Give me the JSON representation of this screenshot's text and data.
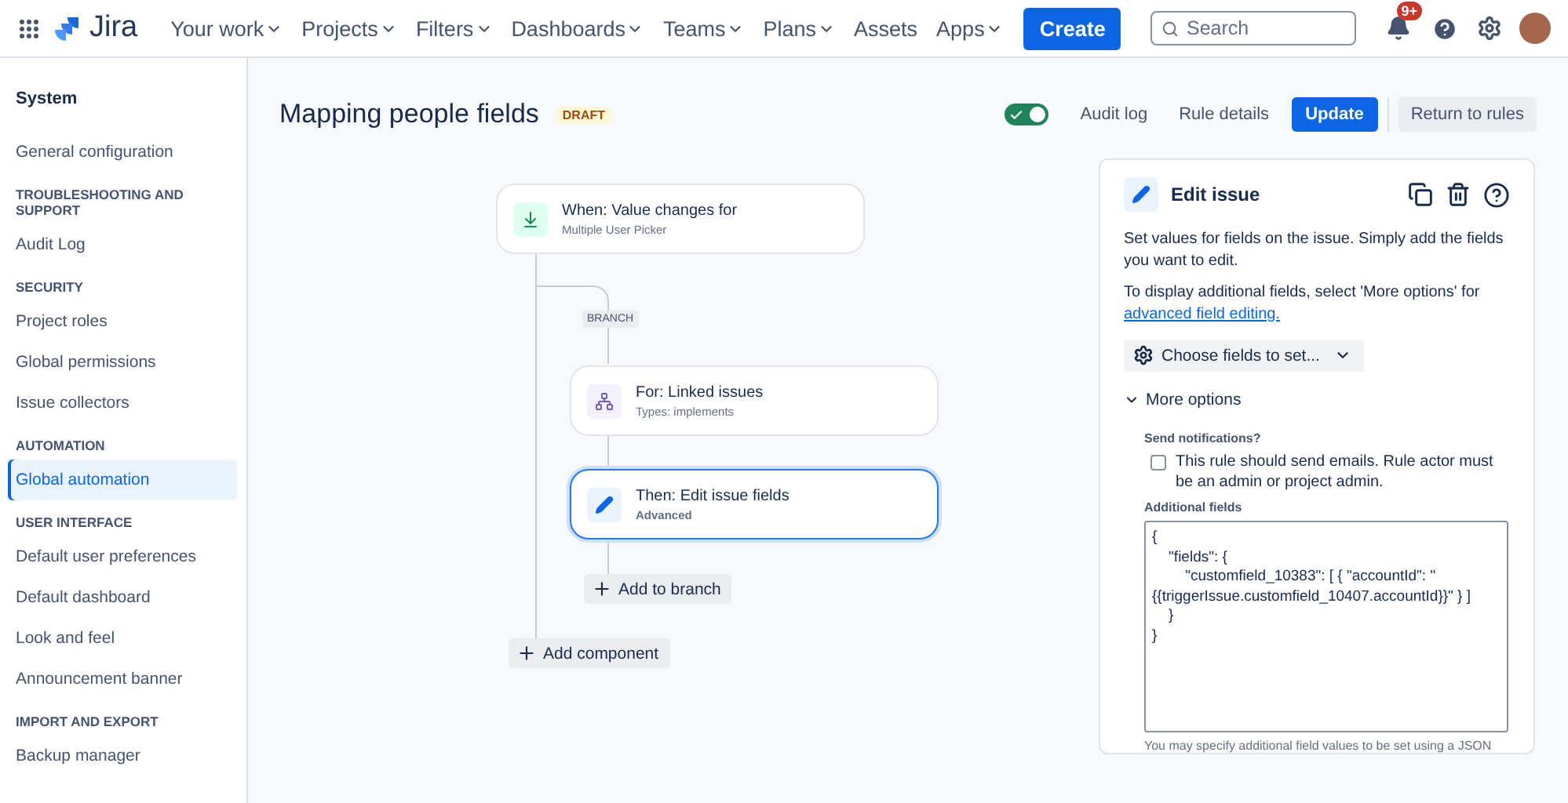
{
  "nav": {
    "product": "Jira",
    "items": [
      {
        "label": "Your work",
        "dropdown": true
      },
      {
        "label": "Projects",
        "dropdown": true
      },
      {
        "label": "Filters",
        "dropdown": true
      },
      {
        "label": "Dashboards",
        "dropdown": true
      },
      {
        "label": "Teams",
        "dropdown": true
      },
      {
        "label": "Plans",
        "dropdown": true
      },
      {
        "label": "Assets",
        "dropdown": false
      },
      {
        "label": "Apps",
        "dropdown": true
      }
    ],
    "create": "Create",
    "search": {
      "placeholder": "Search"
    },
    "notifications_badge": "9+"
  },
  "sidebar": {
    "title": "System",
    "sections": [
      {
        "items": [
          {
            "label": "General configuration",
            "selected": false
          }
        ]
      },
      {
        "heading": "TROUBLESHOOTING AND SUPPORT",
        "items": [
          {
            "label": "Audit Log",
            "selected": false
          }
        ]
      },
      {
        "heading": "SECURITY",
        "items": [
          {
            "label": "Project roles",
            "selected": false
          },
          {
            "label": "Global permissions",
            "selected": false
          },
          {
            "label": "Issue collectors",
            "selected": false
          }
        ]
      },
      {
        "heading": "AUTOMATION",
        "items": [
          {
            "label": "Global automation",
            "selected": true
          }
        ]
      },
      {
        "heading": "USER INTERFACE",
        "items": [
          {
            "label": "Default user preferences",
            "selected": false
          },
          {
            "label": "Default dashboard",
            "selected": false
          },
          {
            "label": "Look and feel",
            "selected": false
          },
          {
            "label": "Announcement banner",
            "selected": false
          }
        ]
      },
      {
        "heading": "IMPORT AND EXPORT",
        "items": [
          {
            "label": "Backup manager",
            "selected": false
          }
        ]
      }
    ]
  },
  "header": {
    "title": "Mapping people fields",
    "status": "DRAFT",
    "rule_enabled": true,
    "actions": [
      "Audit log",
      "Rule details"
    ],
    "update": "Update",
    "return": "Return to rules"
  },
  "flow": {
    "trigger": {
      "title": "When: Value changes for",
      "subtitle": "Multiple User Picker"
    },
    "branch_label": "BRANCH",
    "components": [
      {
        "kind": "branch",
        "title": "For: Linked issues",
        "subtitle": "Types: implements",
        "selected": false
      },
      {
        "kind": "action",
        "title": "Then: Edit issue fields",
        "subtitle": "Advanced",
        "selected": true
      }
    ],
    "add_to_branch": "Add to branch",
    "add_component": "Add component"
  },
  "panel": {
    "title": "Edit issue",
    "description": "Set values for fields on the issue. Simply add the fields you want to edit.",
    "hint": "To display additional fields, select 'More options' for",
    "hint_link": "advanced field editing.",
    "choose_fields": "Choose fields to set...",
    "more_options": {
      "label": "More options",
      "expanded": true
    },
    "send_notifications": {
      "label": "Send notifications?",
      "checked": false,
      "text": "This rule should send emails. Rule actor must be an admin or project admin."
    },
    "additional_fields": {
      "label": "Additional fields",
      "value": "{\n    \"fields\": {\n        \"customfield_10383\": [ { \"accountId\": \"\n{{triggerIssue.customfield_10407.accountId}}\" } ]\n    }\n}",
      "help": "You may specify additional field values to be set using a JSON"
    }
  }
}
